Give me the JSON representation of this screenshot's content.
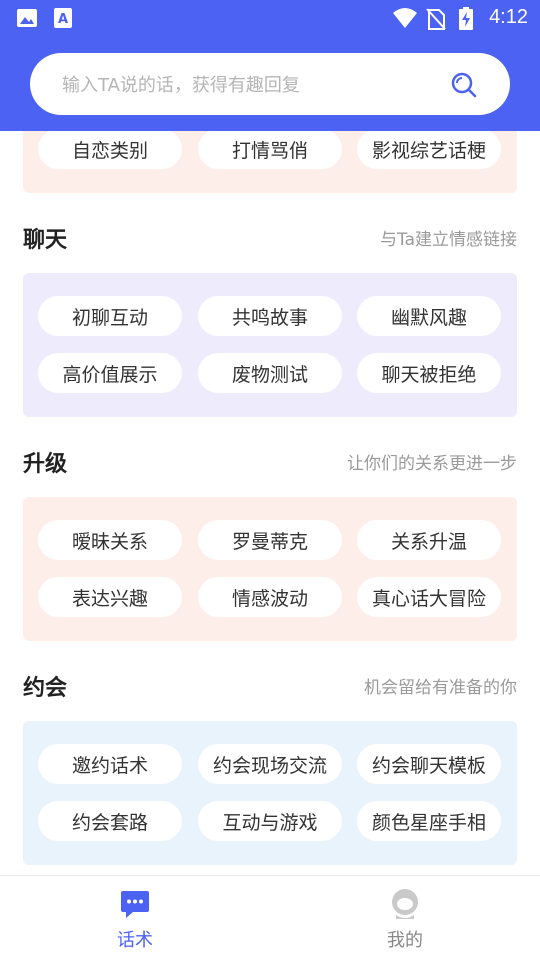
{
  "status_bar": {
    "time": "4:12",
    "icons": [
      "image-icon",
      "a-text-icon",
      "wifi-icon",
      "no-sim-icon",
      "battery-charging-icon"
    ]
  },
  "search": {
    "placeholder": "输入TA说的话，获得有趣回复",
    "icon": "search-icon"
  },
  "sections": {
    "top": {
      "chips": [
        "自恋类别",
        "打情骂俏",
        "影视综艺话梗"
      ]
    },
    "chat": {
      "title": "聊天",
      "subtitle": "与Ta建立情感链接",
      "chips": [
        "初聊互动",
        "共鸣故事",
        "幽默风趣",
        "高价值展示",
        "废物测试",
        "聊天被拒绝"
      ]
    },
    "upgrade": {
      "title": "升级",
      "subtitle": "让你们的关系更进一步",
      "chips": [
        "暧昧关系",
        "罗曼蒂克",
        "关系升温",
        "表达兴趣",
        "情感波动",
        "真心话大冒险"
      ]
    },
    "date": {
      "title": "约会",
      "subtitle": "机会留给有准备的你",
      "chips": [
        "邀约话术",
        "约会现场交流",
        "约会聊天模板",
        "约会套路",
        "互动与游戏",
        "颜色星座手相"
      ]
    }
  },
  "colors": {
    "brand": "#4b62f3",
    "card_pink": "#fdeeea",
    "card_purple": "#eeebfd",
    "card_blue": "#e9f3fc",
    "nav_active": "#4b62f3",
    "nav_inactive": "#888888"
  },
  "bottom_nav": {
    "items": [
      {
        "label": "话术",
        "icon": "chat-bubble-icon",
        "active": true
      },
      {
        "label": "我的",
        "icon": "profile-icon",
        "active": false
      }
    ]
  }
}
